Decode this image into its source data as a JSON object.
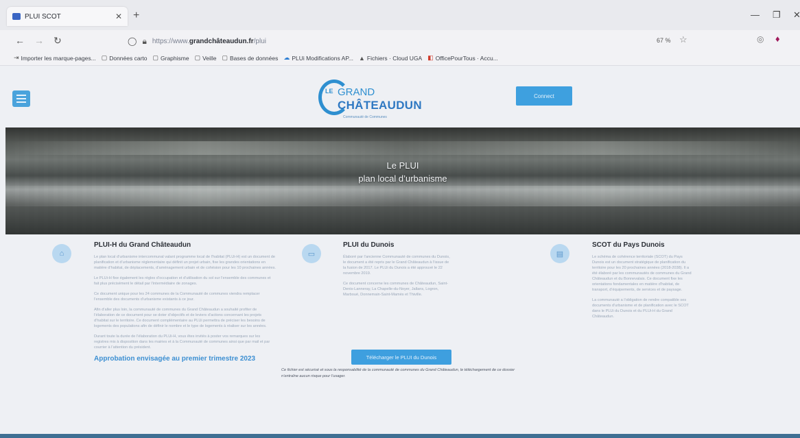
{
  "browser": {
    "tab_title": "PLUI SCOT",
    "url_prefix": "https://www.",
    "url_host": "grandchâteaudun.fr",
    "url_path": "/plui",
    "zoom": "67 %",
    "bookmarks": [
      {
        "label": "Importer les marque-pages...",
        "icon": "import-icon"
      },
      {
        "label": "Données carto",
        "icon": "folder-icon"
      },
      {
        "label": "Graphisme",
        "icon": "folder-icon"
      },
      {
        "label": "Veille",
        "icon": "folder-icon"
      },
      {
        "label": "Bases de données",
        "icon": "folder-icon"
      },
      {
        "label": "PLUi Modifications AP...",
        "icon": "cloud-icon"
      },
      {
        "label": "Fichiers · Cloud UGA",
        "icon": "triangle-icon"
      },
      {
        "label": "OfficePourTous · Accu...",
        "icon": "office-icon"
      }
    ]
  },
  "site": {
    "logo_le": "LE",
    "logo_grand": "GRAND",
    "logo_city": "CHÂTEAUDUN",
    "logo_tag": "Communauté de Communes",
    "connect_label": "Connect",
    "hero_title_1": "Le PLUI",
    "hero_title_2": "plan local d’urbanisme"
  },
  "columns": [
    {
      "title": "PLUI-H du Grand Châteaudun",
      "paragraphs": [
        "Le plan local d’urbanisme intercommunal valant programme local de l’habitat (PLUi-H) est un document de planification et d’urbanisme réglementaire qui définit un projet urbain, fixe les grandes orientations en matière d’habitat, de déplacements, d’aménagement urbain et de cohésion pour les 10 prochaines années.",
        "Le PLUi-H fixe également les règles d’occupation et d’utilisation du sol sur l’ensemble des communes et fait plus précisément le détail par l’intermédiaire de zonages.",
        "Ce document unique pour les 24 communes de la Communauté de communes viendra remplacer l’ensemble des documents d’urbanisme existants à ce jour.",
        "Afin d’aller plus loin, la communauté de communes du Grand Châteaudun a souhaité profiter de l’élaboration de ce document pour se doter d’objectifs et de leviers d’actions concernant les projets d’habitat sur le territoire. Ce document complémentaire au PLUi permettra de préciser les besoins de logements des populations afin de définir le nombre et le type de logements à réaliser sur les années.",
        "Durant toute la durée de l’élaboration du PLUi-H, vous êtes invités à poster vos remarques sur les registres mis à disposition dans les mairies et à la Communauté de communes ainsi que par mail et par courrier à l’attention du président."
      ],
      "highlight": "Approbation envisagée au premier trimestre 2023"
    },
    {
      "title": "PLUI du Dunois",
      "paragraphs": [
        "Élaboré par l’ancienne Communauté de communes du Dunois, le document a été repris par le Grand Châteaudun à l’issue de la fusion de 2017. Le PLUi du Dunois a été approuvé le 22 novembre 2019.",
        "Ce document concerne les communes de Châteaudun, Saint-Denis-Lanneray, La Chapelle-du-Noyer, Jallans, Logron, Marboué, Donnemain-Saint-Mamès et Thiville."
      ],
      "download_label": "Télécharger le PLUI du Dunois",
      "disclaimer": "Ce fichier est sécurisé et sous la responsabilité de la communauté de communes du Grand Châteaudun, le téléchargement de ce dossier n’entraîne aucun risque pour l’usager."
    },
    {
      "title": "SCOT du Pays Dunois",
      "paragraphs": [
        "Le schéma de cohérence territoriale (SCOT) du Pays Dunois est un document stratégique de planification du territoire pour les 20 prochaines années (2018-2038). Il a été élaboré par les communautés de communes du Grand Châteaudun et du Bonnevalais. Ce document fixe les orientations fondamentales en matière d’habitat, de transport, d’équipements, de services et de paysage.",
        "La communauté a l’obligation de rendre compatible ses documents d’urbanisme et de planification avec le SCOT dans le PLUi du Dunois et du PLUi-H du Grand Châteaudun."
      ]
    }
  ]
}
